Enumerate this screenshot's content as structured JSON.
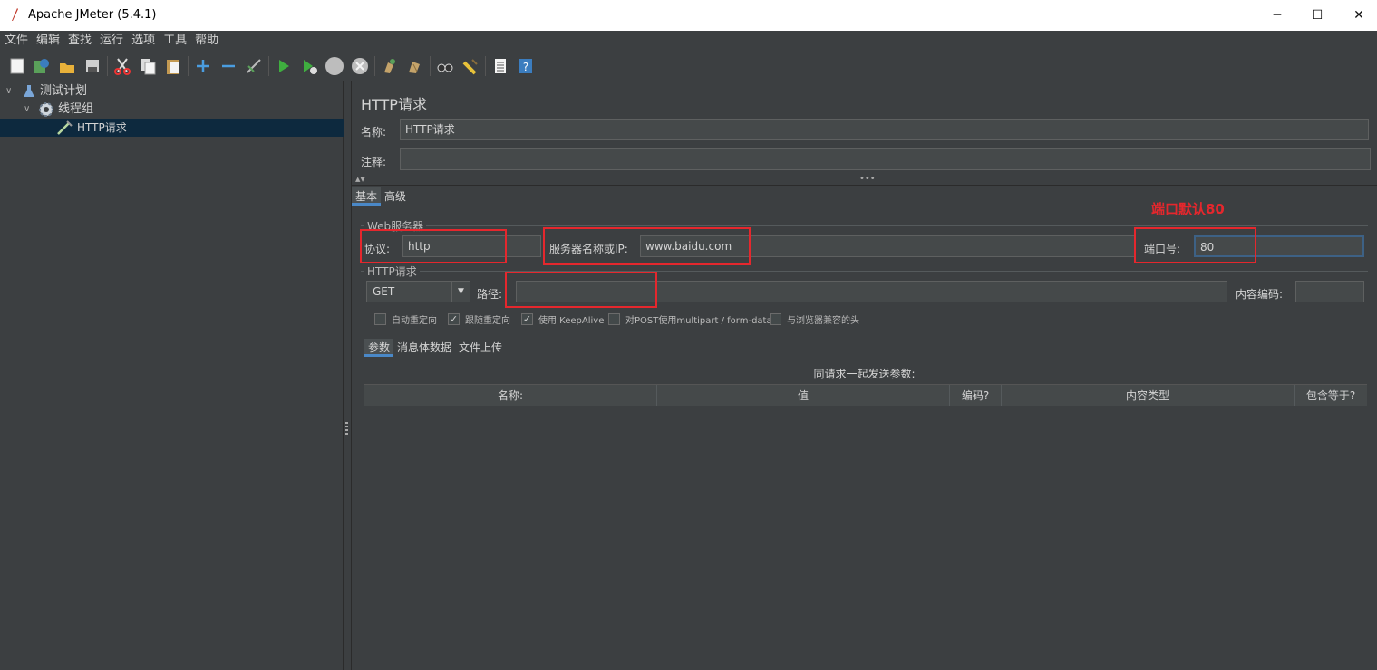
{
  "window": {
    "title": "Apache JMeter (5.4.1)",
    "minimize": "─",
    "maximize": "☐",
    "close": "✕"
  },
  "menu": [
    "文件",
    "编辑",
    "查找",
    "运行",
    "选项",
    "工具",
    "帮助"
  ],
  "toolbar_icons": [
    "new-icon",
    "templates-icon",
    "open-icon",
    "save-icon",
    "cut-icon",
    "copy-icon",
    "paste-icon",
    "expand-icon",
    "collapse-icon",
    "toggle-icon",
    "start-icon",
    "start-no-pause-icon",
    "stop-icon",
    "shutdown-icon",
    "clear-icon",
    "clear-all-icon",
    "search-icon",
    "reset-search-icon",
    "function-helper-icon",
    "help-icon"
  ],
  "tree": {
    "test_plan": "测试计划",
    "thread_group": "线程组",
    "http_request": "HTTP请求"
  },
  "panel": {
    "title": "HTTP请求",
    "name_label": "名称:",
    "name_value": "HTTP请求",
    "comment_label": "注释:",
    "comment_value": "",
    "tabs": [
      "基本",
      "高级"
    ],
    "web_server_group": "Web服务器",
    "protocol_label": "协议:",
    "protocol_value": "http",
    "server_label": "服务器名称或IP:",
    "server_value": "www.baidu.com",
    "port_label": "端口号:",
    "port_value": "80",
    "annotation": "端口默认80",
    "http_request_group": "HTTP请求",
    "method_value": "GET",
    "path_label": "路径:",
    "path_value": "",
    "encoding_label": "内容编码:",
    "encoding_value": "",
    "checkboxes": [
      {
        "label": "自动重定向",
        "checked": false
      },
      {
        "label": "跟随重定向",
        "checked": true
      },
      {
        "label": "使用 KeepAlive",
        "checked": true
      },
      {
        "label": "对POST使用multipart / form-data",
        "checked": false
      },
      {
        "label": "与浏览器兼容的头",
        "checked": false
      }
    ],
    "sub_tabs": [
      "参数",
      "消息体数据",
      "文件上传"
    ],
    "params_caption": "同请求一起发送参数:",
    "columns": [
      "名称:",
      "值",
      "编码?",
      "内容类型",
      "包含等于?"
    ]
  },
  "colors": {
    "background": "#3c3f41",
    "field": "#45494a",
    "selection": "#0d293e",
    "annotation": "#e5272d",
    "accent": "#4a88c7"
  }
}
